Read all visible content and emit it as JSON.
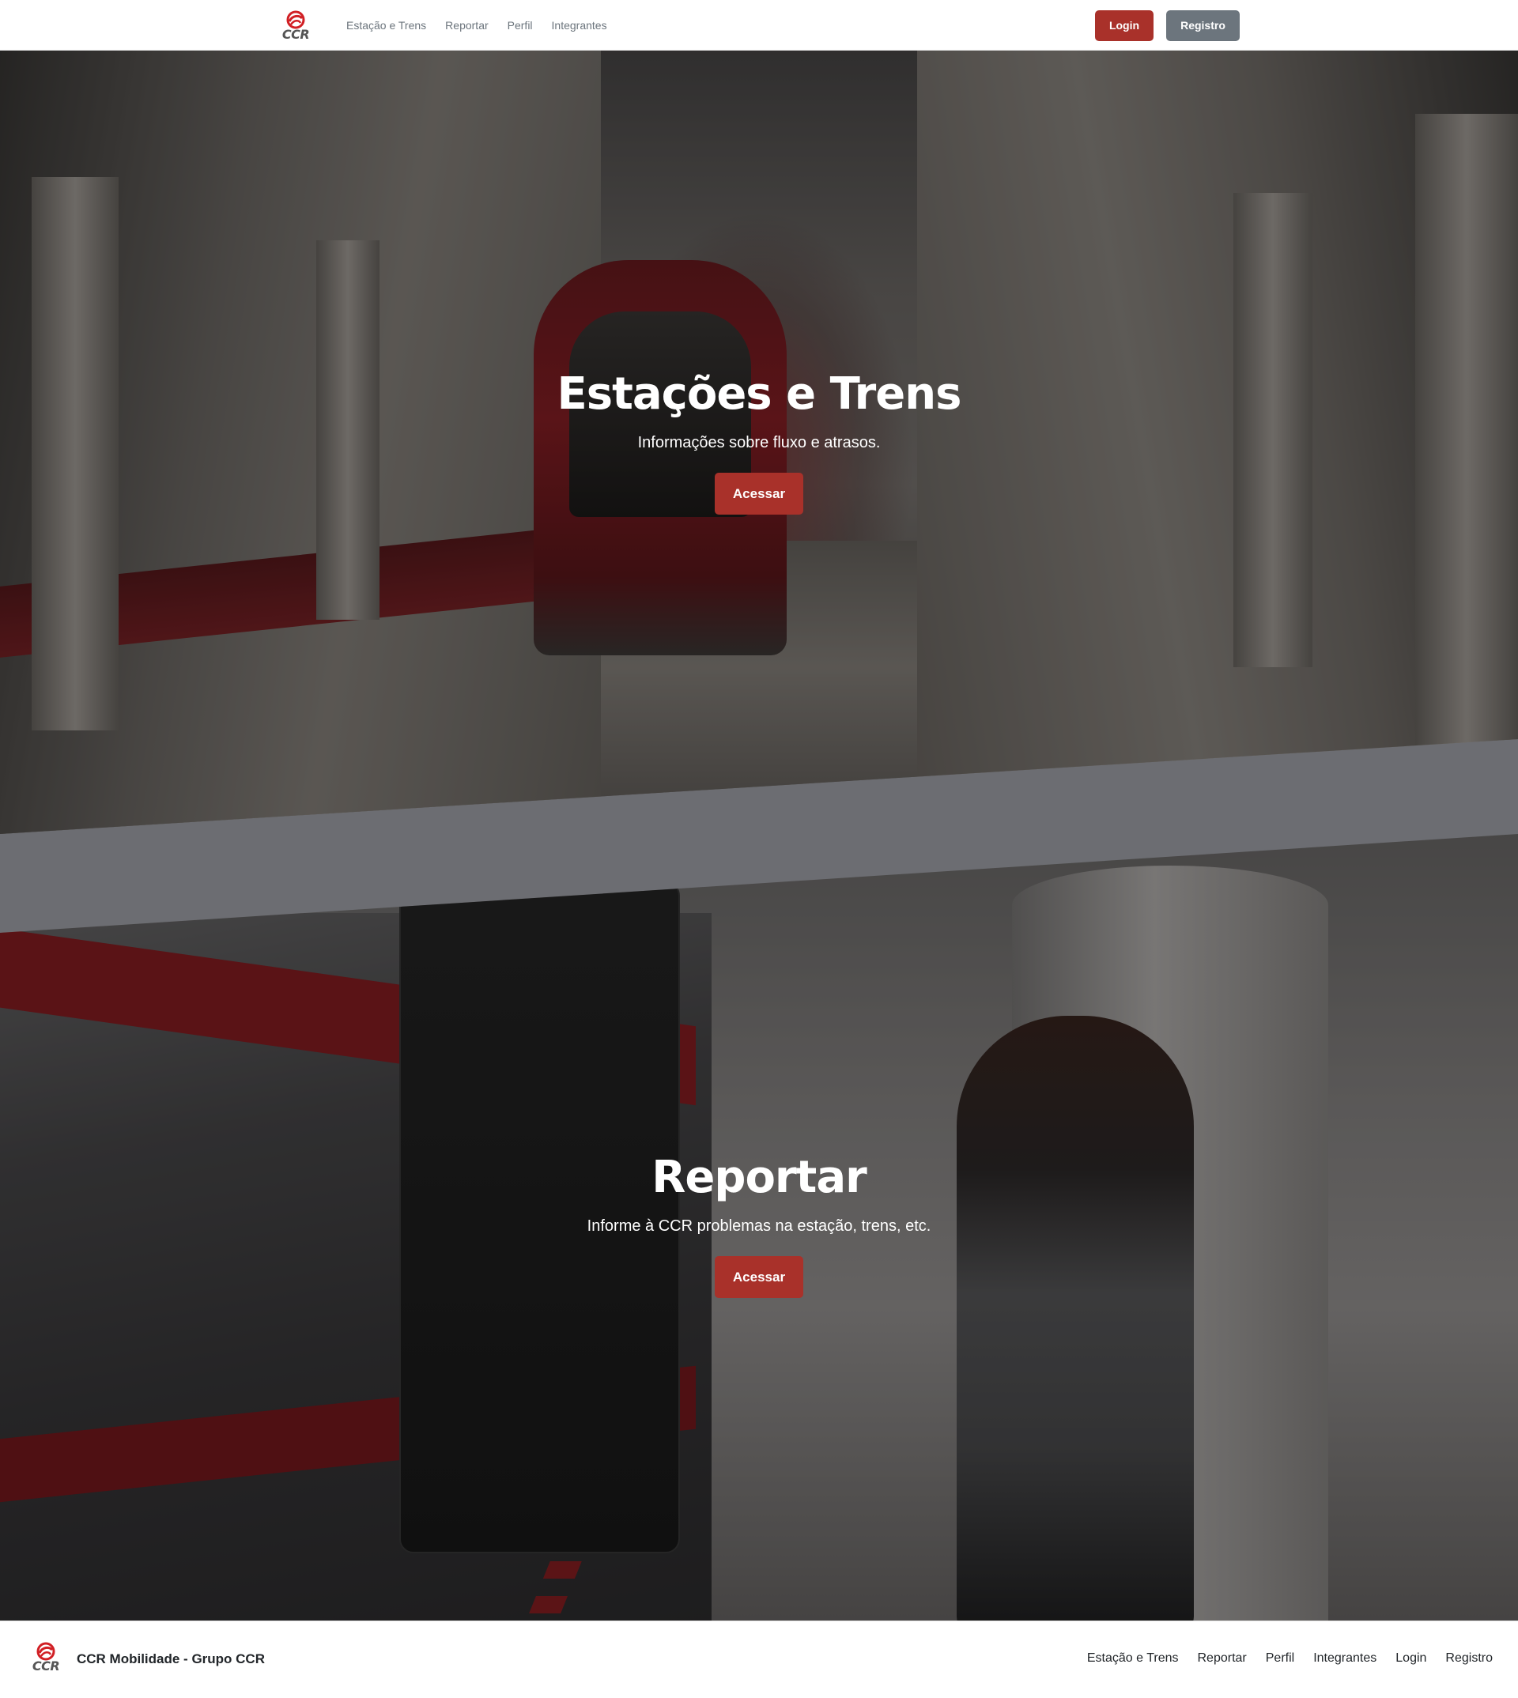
{
  "brand": {
    "logo_text": "CCR",
    "accent_color": "#a9312a",
    "secondary_color": "#6c757d"
  },
  "navbar": {
    "links": [
      "Estação e Trens",
      "Reportar",
      "Perfil",
      "Integrantes"
    ],
    "login_label": "Login",
    "registro_label": "Registro"
  },
  "hero_stations": {
    "title": "Estações e Trens",
    "subtitle": "Informações sobre fluxo e atrasos.",
    "button_label": "Acessar"
  },
  "hero_report": {
    "title": "Reportar",
    "subtitle": "Informe à CCR problemas na estação, trens, etc.",
    "button_label": "Acessar"
  },
  "footer": {
    "brand": "CCR Mobilidade - Grupo CCR",
    "logo_text": "CCR",
    "links": [
      "Estação e Trens",
      "Reportar",
      "Perfil",
      "Integrantes",
      "Login",
      "Registro"
    ]
  }
}
